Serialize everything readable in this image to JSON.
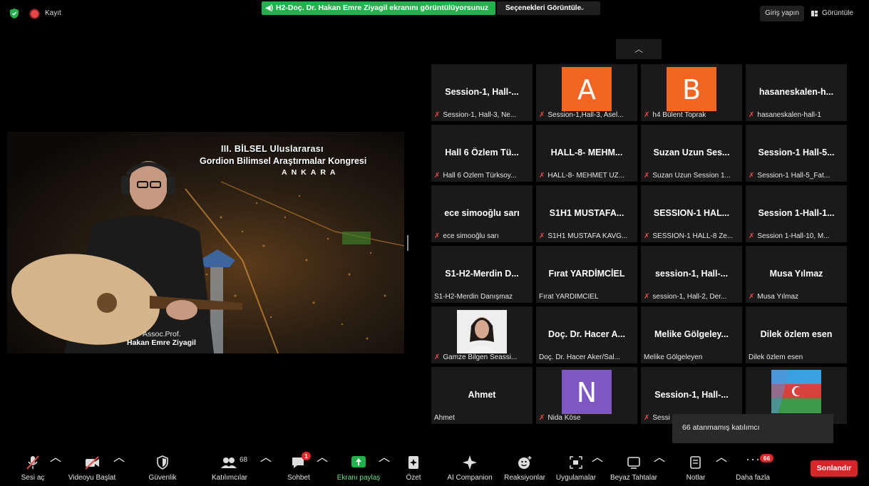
{
  "topbar": {
    "recording_label": "Kayıt",
    "share_banner": "H2-Doç. Dr. Hakan Emre Ziyagil ekranını görüntülüyorsunuz",
    "view_options_label": "Seçenekleri Görüntüle",
    "signin_label": "Giriş yapın",
    "view_label": "Görüntüle",
    "colors": {
      "share_green": "#22b14c",
      "record_red": "#e8474a"
    }
  },
  "screen": {
    "title_line1": "III. BİLSEL Uluslararası",
    "title_line2": "Gordion Bilimsel Araştırmalar Kongresi",
    "title_line3": "ANKARA",
    "signature_line1": "Assoc.Prof.",
    "signature_line2": "Hakan Emre Ziyagil"
  },
  "gallery": {
    "tiles": [
      {
        "big": "Session-1,  Hall-...",
        "name": "Session-1, Hall-3, Ne...",
        "muted": true
      },
      {
        "avatar": "A",
        "avatar_color": "#f26522",
        "name": "Session-1,Hall-3, Asel...",
        "muted": true
      },
      {
        "avatar": "B",
        "avatar_color": "#f26522",
        "name": "h4 Bülent Toprak",
        "muted": true
      },
      {
        "big": "hasaneskalen-h...",
        "name": "hasaneskalen-hall-1",
        "muted": true
      },
      {
        "big": "Hall 6 Özlem Tü...",
        "name": "Hall 6 Özlem Türksoy...",
        "muted": true
      },
      {
        "big": "HALL-8-  MEHM...",
        "name": "HALL-8- MEHMET UZ...",
        "muted": true
      },
      {
        "big": "Suzan Uzun Ses...",
        "name": "Suzan Uzun Session 1...",
        "muted": true
      },
      {
        "big": "Session-1  Hall-5...",
        "name": "Session-1 Hall-5_Fat...",
        "muted": true
      },
      {
        "big": "ece simooğlu sarı",
        "name": "ece simooğlu sarı",
        "muted": true
      },
      {
        "big": "S1H1  MUSTAFA...",
        "name": "S1H1 MUSTAFA KAVG...",
        "muted": true
      },
      {
        "big": "SESSION-1  HAL...",
        "name": "SESSION-1 HALL-8 Ze...",
        "muted": true
      },
      {
        "big": "Session  1-Hall-1...",
        "name": "Session 1-Hall-10, M...",
        "muted": true
      },
      {
        "big": "S1-H2-Merdin  D...",
        "name": "S1-H2-Merdin Danışmaz",
        "muted": false
      },
      {
        "big": "Fırat YARDİMCİEL",
        "name": "Fırat YARDİMCİEL",
        "muted": false
      },
      {
        "big": "session-1,  Hall-...",
        "name": "session-1, Hall-2, Der...",
        "muted": true
      },
      {
        "big": "Musa Yılmaz",
        "name": "Musa Yılmaz",
        "muted": true
      },
      {
        "photo": "person",
        "name": "Gamze Bilgen Seassi...",
        "muted": true
      },
      {
        "big": "Doç. Dr. Hacer A...",
        "name": "Doç. Dr. Hacer Aker/Sal...",
        "muted": false
      },
      {
        "big": "Melike  Gölgeley...",
        "name": "Melike Gölgeleyen",
        "muted": false
      },
      {
        "big": "Dilek özlem esen",
        "name": "Dilek özlem esen",
        "muted": false
      },
      {
        "big": "Ahmet",
        "name": "Ahmet",
        "muted": false
      },
      {
        "avatar": "N",
        "avatar_color": "#7e57c2",
        "name": "Nida Köse",
        "muted": true
      },
      {
        "big": "Session-1,  Hall-...",
        "name": "Sessi",
        "muted": true
      },
      {
        "photo": "flag",
        "name": "",
        "muted": false
      }
    ],
    "tooltip": "66 atanmamış katılımcı"
  },
  "toolbar": {
    "mute": "Sesi aç",
    "video": "Videoyu Başlat",
    "security": "Güvenlik",
    "participants": "Katılımcılar",
    "participants_count": "68",
    "chat": "Sohbet",
    "chat_badge": "1",
    "share": "Ekranı paylaş",
    "summary": "Özet",
    "ai": "AI Companion",
    "reactions": "Reaksiyonlar",
    "apps": "Uygulamalar",
    "whiteboard": "Beyaz Tahtalar",
    "notes": "Notlar",
    "more": "Daha fazla",
    "more_badge": "66",
    "end": "Sonlandır"
  }
}
